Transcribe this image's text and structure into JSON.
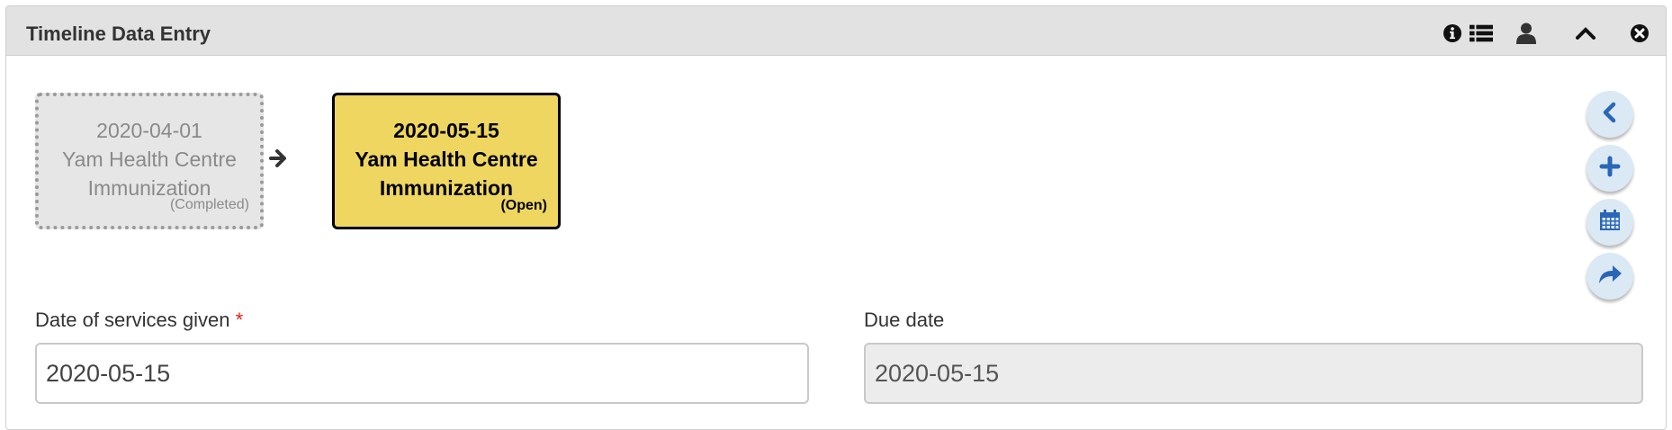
{
  "panel": {
    "title": "Timeline Data Entry",
    "header_icons": [
      "info-icon",
      "list-icon",
      "user-icon",
      "chevron-up-icon",
      "close-circle-icon"
    ]
  },
  "timeline": {
    "events": [
      {
        "date": "2020-04-01",
        "org_unit": "Yam Health Centre",
        "program_stage": "Immunization",
        "status": "(Completed)"
      },
      {
        "date": "2020-05-15",
        "org_unit": "Yam Health Centre",
        "program_stage": "Immunization",
        "status": "(Open)"
      }
    ],
    "side_buttons": [
      "chevron-left-icon",
      "plus-icon",
      "calendar-icon",
      "share-arrow-icon"
    ]
  },
  "form": {
    "date_of_services": {
      "label": "Date of services given",
      "required_mark": "*",
      "value": "2020-05-15"
    },
    "due_date": {
      "label": "Due date",
      "value": "2020-05-15"
    }
  },
  "colors": {
    "header_bg": "#e2e2e2",
    "open_event_bg": "#eed661",
    "completed_event_bg": "#e6e6e6",
    "action_button_bg": "#dbe9f5",
    "icon_blue": "#2a66b8",
    "required": "#e0201b"
  }
}
